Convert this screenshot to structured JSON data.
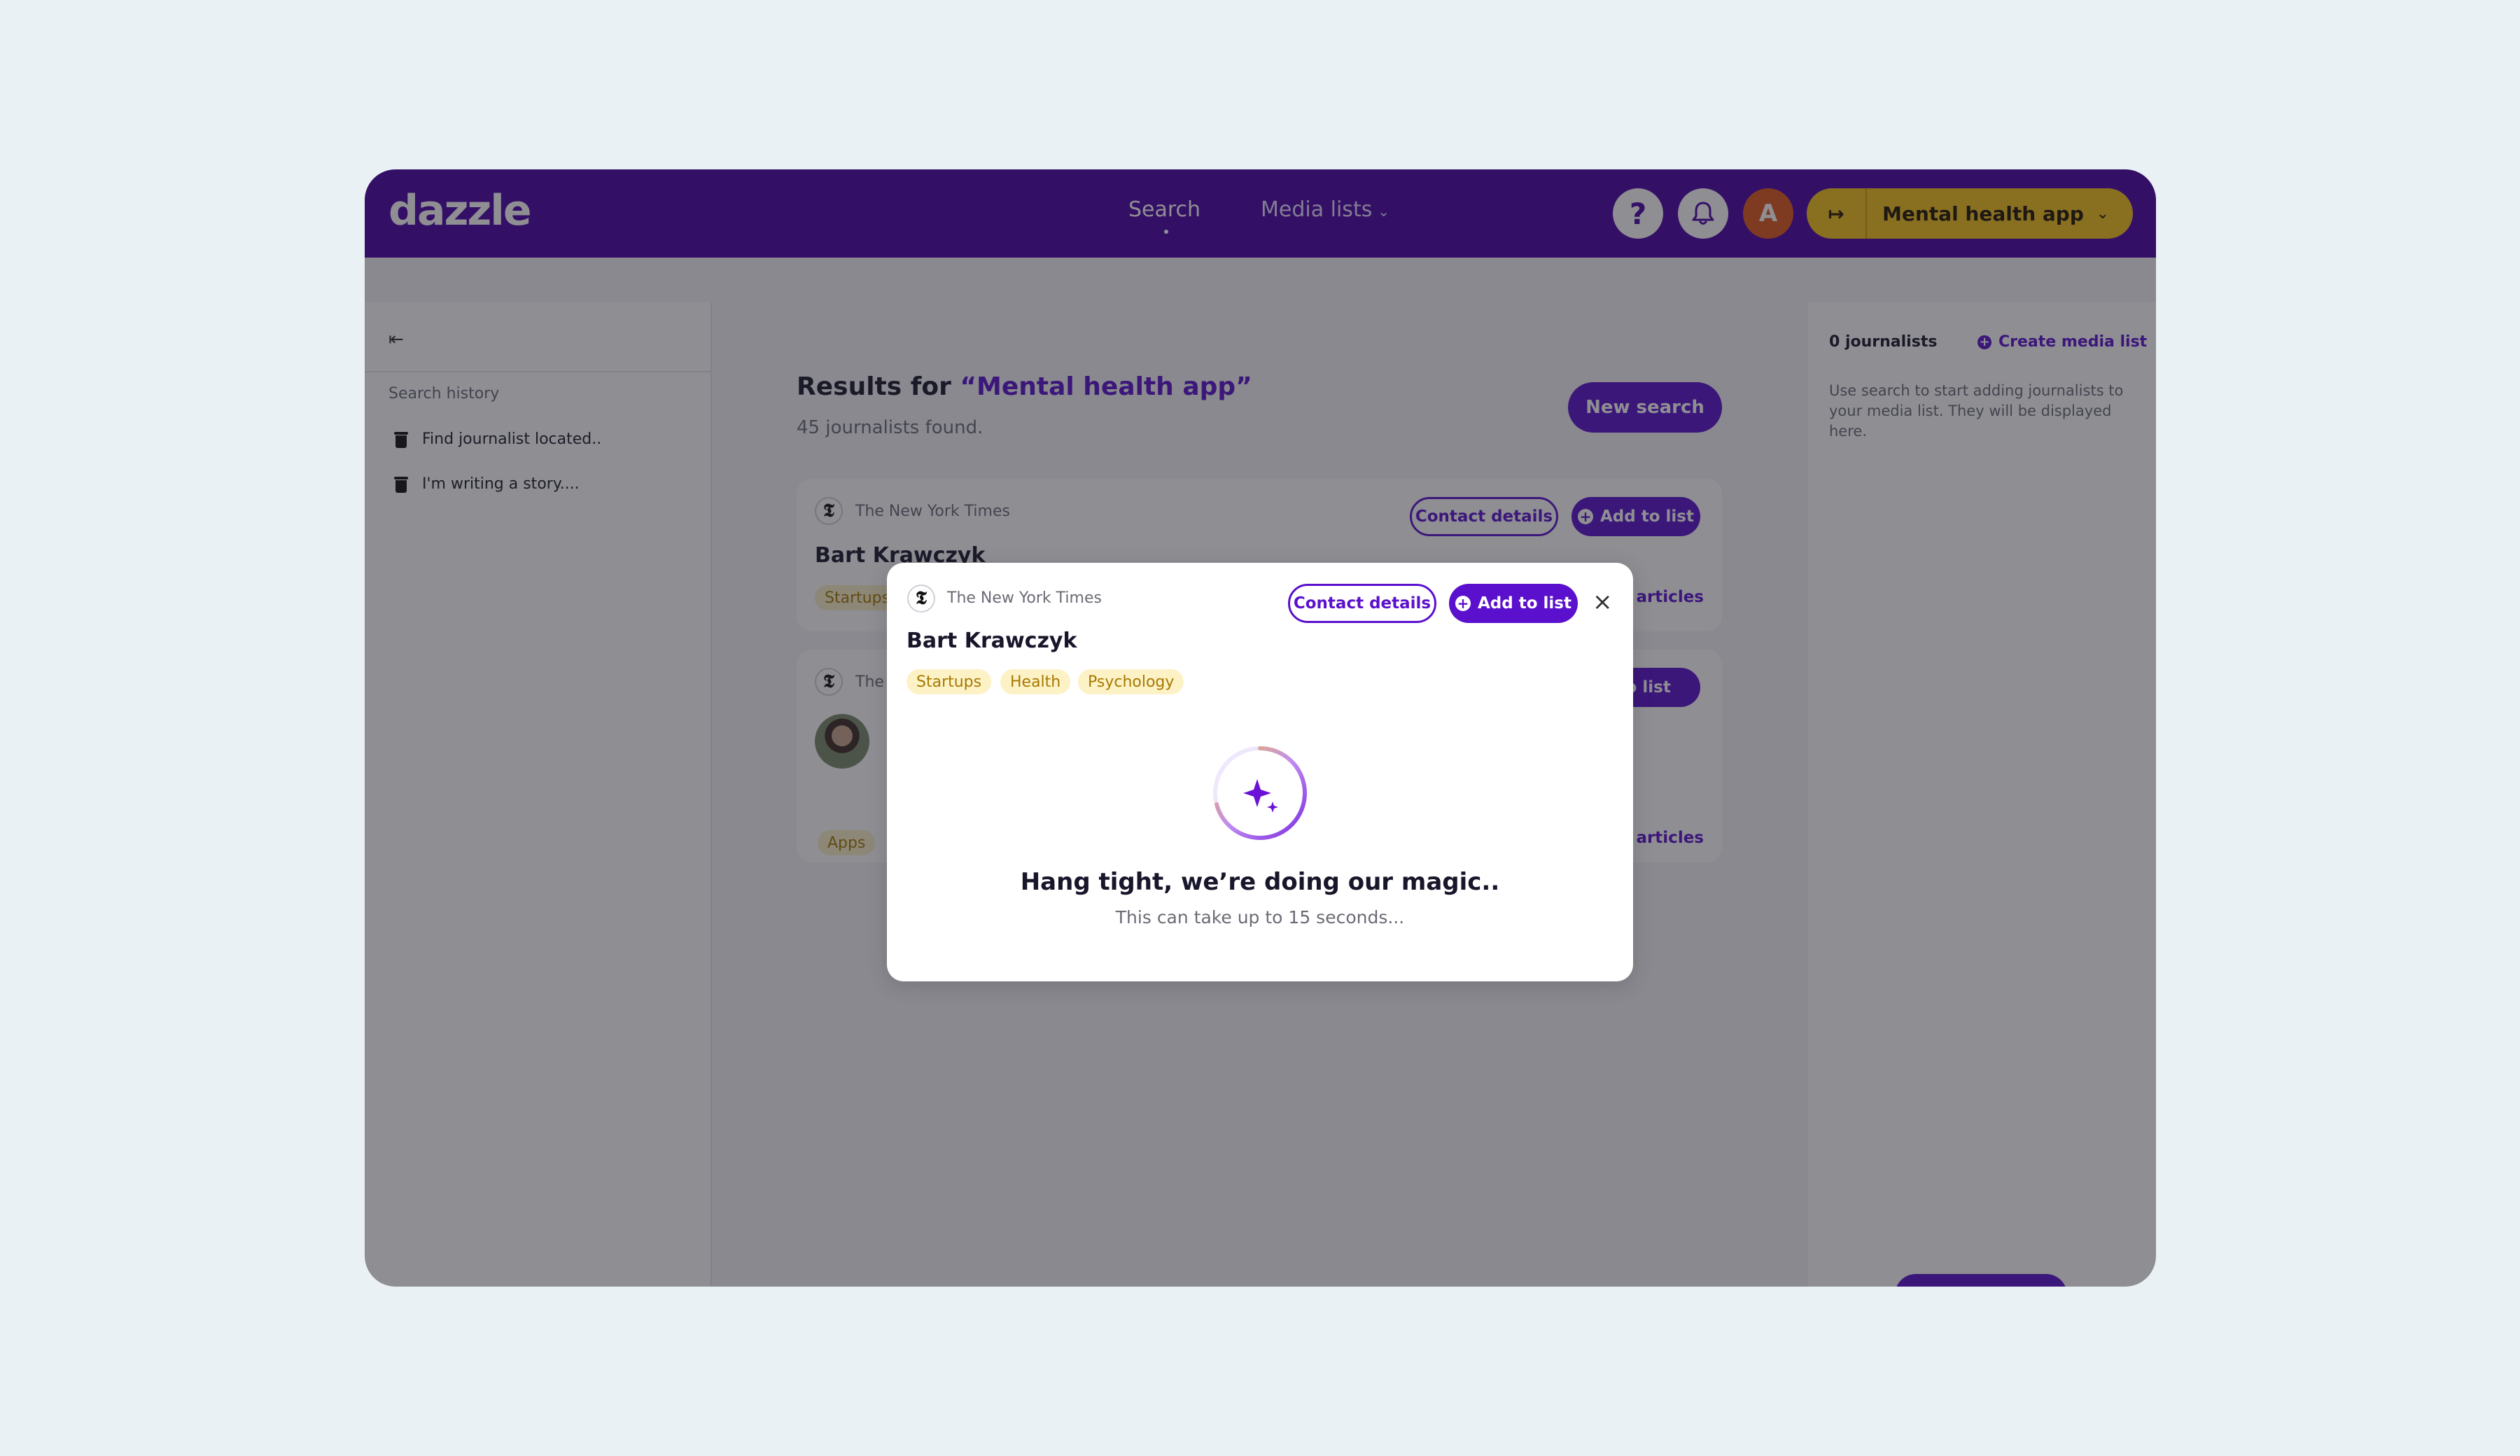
{
  "app": {
    "logo": "dazzle"
  },
  "nav": {
    "search_label": "Search",
    "media_lists_label": "Media lists",
    "media_lists_caret": "⌄"
  },
  "header": {
    "help_glyph": "?",
    "avatar_initial": "A",
    "project_switch_glyph": "↦",
    "project_name": "Mental health app",
    "project_caret": "⌄"
  },
  "sidebar": {
    "collapse_glyph": "⇤",
    "history_label": "Search history",
    "history": [
      {
        "label": "Find journalist located.."
      },
      {
        "label": "I'm writing a story...."
      }
    ]
  },
  "results": {
    "title_prefix": "Results for ",
    "query": "“Mental health app”",
    "count_text": "45 journalists found.",
    "new_search_label": "New search"
  },
  "cards": [
    {
      "publication": "The New York Times",
      "logo_glyph": "𝕿",
      "name": "Bart Krawczyk",
      "tags": [
        "Startups"
      ],
      "contact_label": "Contact details",
      "add_label": "Add to list",
      "articles_link": "d articles"
    },
    {
      "publication": "The",
      "logo_glyph": "𝕿",
      "tags": [
        "Apps"
      ],
      "add_label": "d to list",
      "articles_link": "d articles"
    }
  ],
  "right_panel": {
    "count_text": "0 journalists",
    "create_label": "Create media list",
    "description": "Use search to start adding journalists to your media list. They will be displayed here."
  },
  "modal": {
    "publication": "The New York Times",
    "logo_glyph": "𝕿",
    "name": "Bart Krawczyk",
    "contact_label": "Contact details",
    "add_label": "Add to list",
    "close_glyph": "×",
    "tags": [
      "Startups",
      "Health",
      "Psychology"
    ],
    "loading_title": "Hang tight, we’re doing our magic..",
    "loading_subtitle": "This can take up to 15 seconds..."
  },
  "colors": {
    "brand_purple": "#4b00a5",
    "accent_purple": "#5a10cc",
    "project_yellow": "#f4c21a",
    "avatar_orange": "#e0581c",
    "tag_bg": "#fdf1c6",
    "tag_text": "#a67a00",
    "page_bg": "#eaf1f5"
  },
  "icons": {
    "help": "question-mark-icon",
    "notifications": "bell-icon",
    "project_switch": "switch-project-icon",
    "history_item": "trash-icon",
    "loading": "sparkle-spinner-icon"
  }
}
